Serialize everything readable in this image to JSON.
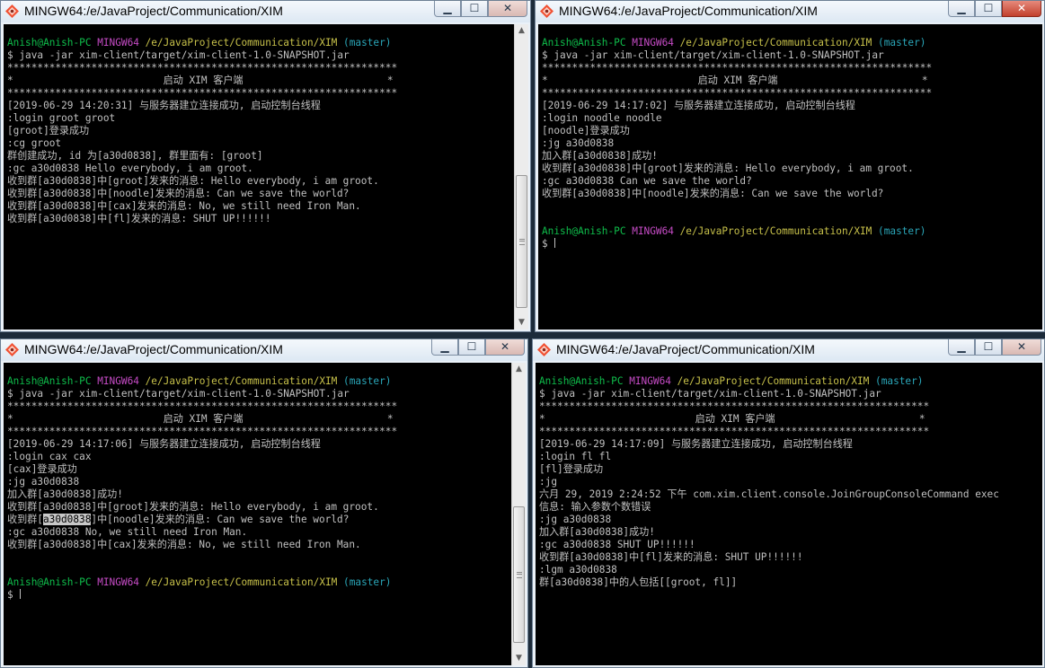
{
  "icons": {
    "app": "git-bash-icon",
    "minimize": "minimize-icon",
    "maximize": "maximize-icon",
    "close": "close-icon"
  },
  "colors": {
    "green": "#0fbd4b",
    "magenta": "#c54bc5",
    "yellow": "#c7c14a",
    "cyan": "#2aa6b8",
    "text": "#c0c0c0",
    "background": "#000000"
  },
  "windows": [
    {
      "title": "MINGW64:/e/JavaProject/Communication/XIM",
      "lines": [
        [
          [
            "Anish@Anish-PC ",
            "g"
          ],
          [
            "MINGW64 ",
            "m"
          ],
          [
            "/e/JavaProject/Communication/XIM",
            "y"
          ],
          [
            " (master)",
            "c"
          ]
        ],
        [
          [
            "$ java -jar xim-client/target/xim-client-1.0-SNAPSHOT.jar",
            "w"
          ]
        ],
        [
          [
            "*****************************************************************",
            "w"
          ]
        ],
        [
          [
            "*                         启动 XIM 客户端                        *",
            "w"
          ]
        ],
        [
          [
            "*****************************************************************",
            "w"
          ]
        ],
        [
          [
            "[2019-06-29 14:20:31] 与服务器建立连接成功, 启动控制台线程",
            "w"
          ]
        ],
        [
          [
            ":login groot groot",
            "w"
          ]
        ],
        [
          [
            "[groot]登录成功",
            "w"
          ]
        ],
        [
          [
            ":cg groot",
            "w"
          ]
        ],
        [
          [
            "群创建成功, id 为[a30d0838], 群里面有: [groot]",
            "w"
          ]
        ],
        [
          [
            ":gc a30d0838 Hello everybody, i am groot.",
            "w"
          ]
        ],
        [
          [
            "收到群[a30d0838]中[groot]发来的消息: Hello everybody, i am groot.",
            "w"
          ]
        ],
        [
          [
            "收到群[a30d0838]中[noodle]发来的消息: Can we save the world?",
            "w"
          ]
        ],
        [
          [
            "收到群[a30d0838]中[cax]发来的消息: No, we still need Iron Man.",
            "w"
          ]
        ],
        [
          [
            "收到群[a30d0838]中[fl]发来的消息: SHUT UP!!!!!!",
            "w"
          ]
        ]
      ]
    },
    {
      "title": "MINGW64:/e/JavaProject/Communication/XIM",
      "lines": [
        [
          [
            "Anish@Anish-PC ",
            "g"
          ],
          [
            "MINGW64 ",
            "m"
          ],
          [
            "/e/JavaProject/Communication/XIM",
            "y"
          ],
          [
            " (master)",
            "c"
          ]
        ],
        [
          [
            "$ java -jar xim-client/target/xim-client-1.0-SNAPSHOT.jar",
            "w"
          ]
        ],
        [
          [
            "*****************************************************************",
            "w"
          ]
        ],
        [
          [
            "*                         启动 XIM 客户端                        *",
            "w"
          ]
        ],
        [
          [
            "*****************************************************************",
            "w"
          ]
        ],
        [
          [
            "[2019-06-29 14:17:02] 与服务器建立连接成功, 启动控制台线程",
            "w"
          ]
        ],
        [
          [
            ":login noodle noodle",
            "w"
          ]
        ],
        [
          [
            "[noodle]登录成功",
            "w"
          ]
        ],
        [
          [
            ":jg a30d0838",
            "w"
          ]
        ],
        [
          [
            "加入群[a30d0838]成功!",
            "w"
          ]
        ],
        [
          [
            "收到群[a30d0838]中[groot]发来的消息: Hello everybody, i am groot.",
            "w"
          ]
        ],
        [
          [
            ":gc a30d0838 Can we save the world?",
            "w"
          ]
        ],
        [
          [
            "收到群[a30d0838]中[noodle]发来的消息: Can we save the world?",
            "w"
          ]
        ],
        [
          [
            "",
            "w"
          ]
        ],
        [
          [
            "",
            "w"
          ]
        ],
        [
          [
            "Anish@Anish-PC ",
            "g"
          ],
          [
            "MINGW64 ",
            "m"
          ],
          [
            "/e/JavaProject/Communication/XIM",
            "y"
          ],
          [
            " (master)",
            "c"
          ]
        ],
        [
          [
            "$ ",
            "w"
          ]
        ]
      ]
    },
    {
      "title": "MINGW64:/e/JavaProject/Communication/XIM",
      "lines": [
        [
          [
            "Anish@Anish-PC ",
            "g"
          ],
          [
            "MINGW64 ",
            "m"
          ],
          [
            "/e/JavaProject/Communication/XIM",
            "y"
          ],
          [
            " (master)",
            "c"
          ]
        ],
        [
          [
            "$ java -jar xim-client/target/xim-client-1.0-SNAPSHOT.jar",
            "w"
          ]
        ],
        [
          [
            "*****************************************************************",
            "w"
          ]
        ],
        [
          [
            "*                         启动 XIM 客户端                        *",
            "w"
          ]
        ],
        [
          [
            "*****************************************************************",
            "w"
          ]
        ],
        [
          [
            "[2019-06-29 14:17:06] 与服务器建立连接成功, 启动控制台线程",
            "w"
          ]
        ],
        [
          [
            ":login cax cax",
            "w"
          ]
        ],
        [
          [
            "[cax]登录成功",
            "w"
          ]
        ],
        [
          [
            ":jg a30d0838",
            "w"
          ]
        ],
        [
          [
            "加入群[a30d0838]成功!",
            "w"
          ]
        ],
        [
          [
            "收到群[a30d0838]中[groot]发来的消息: Hello everybody, i am groot.",
            "w"
          ]
        ],
        [
          [
            "收到群[",
            "w"
          ],
          [
            "a30d0838",
            "sel"
          ],
          [
            "]中[noodle]发来的消息: Can we save the world?",
            "w"
          ]
        ],
        [
          [
            ":gc a30d0838 No, we still need Iron Man.",
            "w"
          ]
        ],
        [
          [
            "收到群[a30d0838]中[cax]发来的消息: No, we still need Iron Man.",
            "w"
          ]
        ],
        [
          [
            "",
            "w"
          ]
        ],
        [
          [
            "",
            "w"
          ]
        ],
        [
          [
            "Anish@Anish-PC ",
            "g"
          ],
          [
            "MINGW64 ",
            "m"
          ],
          [
            "/e/JavaProject/Communication/XIM",
            "y"
          ],
          [
            " (master)",
            "c"
          ]
        ],
        [
          [
            "$ ",
            "w"
          ]
        ]
      ]
    },
    {
      "title": "MINGW64:/e/JavaProject/Communication/XIM",
      "lines": [
        [
          [
            "Anish@Anish-PC ",
            "g"
          ],
          [
            "MINGW64 ",
            "m"
          ],
          [
            "/e/JavaProject/Communication/XIM",
            "y"
          ],
          [
            " (master)",
            "c"
          ]
        ],
        [
          [
            "$ java -jar xim-client/target/xim-client-1.0-SNAPSHOT.jar",
            "w"
          ]
        ],
        [
          [
            "*****************************************************************",
            "w"
          ]
        ],
        [
          [
            "*                         启动 XIM 客户端                        *",
            "w"
          ]
        ],
        [
          [
            "*****************************************************************",
            "w"
          ]
        ],
        [
          [
            "[2019-06-29 14:17:09] 与服务器建立连接成功, 启动控制台线程",
            "w"
          ]
        ],
        [
          [
            ":login fl fl",
            "w"
          ]
        ],
        [
          [
            "[fl]登录成功",
            "w"
          ]
        ],
        [
          [
            ":jg",
            "w"
          ]
        ],
        [
          [
            "六月 29, 2019 2:24:52 下午 com.xim.client.console.JoinGroupConsoleCommand exec",
            "w"
          ]
        ],
        [
          [
            "信息: 输入参数个数错误",
            "w"
          ]
        ],
        [
          [
            ":jg a30d0838",
            "w"
          ]
        ],
        [
          [
            "加入群[a30d0838]成功!",
            "w"
          ]
        ],
        [
          [
            ":gc a30d0838 SHUT UP!!!!!!",
            "w"
          ]
        ],
        [
          [
            "收到群[a30d0838]中[fl]发来的消息: SHUT UP!!!!!!",
            "w"
          ]
        ],
        [
          [
            ":lgm a30d0838",
            "w"
          ]
        ],
        [
          [
            "群[a30d0838]中的人包括[[groot, fl]]",
            "w"
          ]
        ]
      ]
    }
  ]
}
